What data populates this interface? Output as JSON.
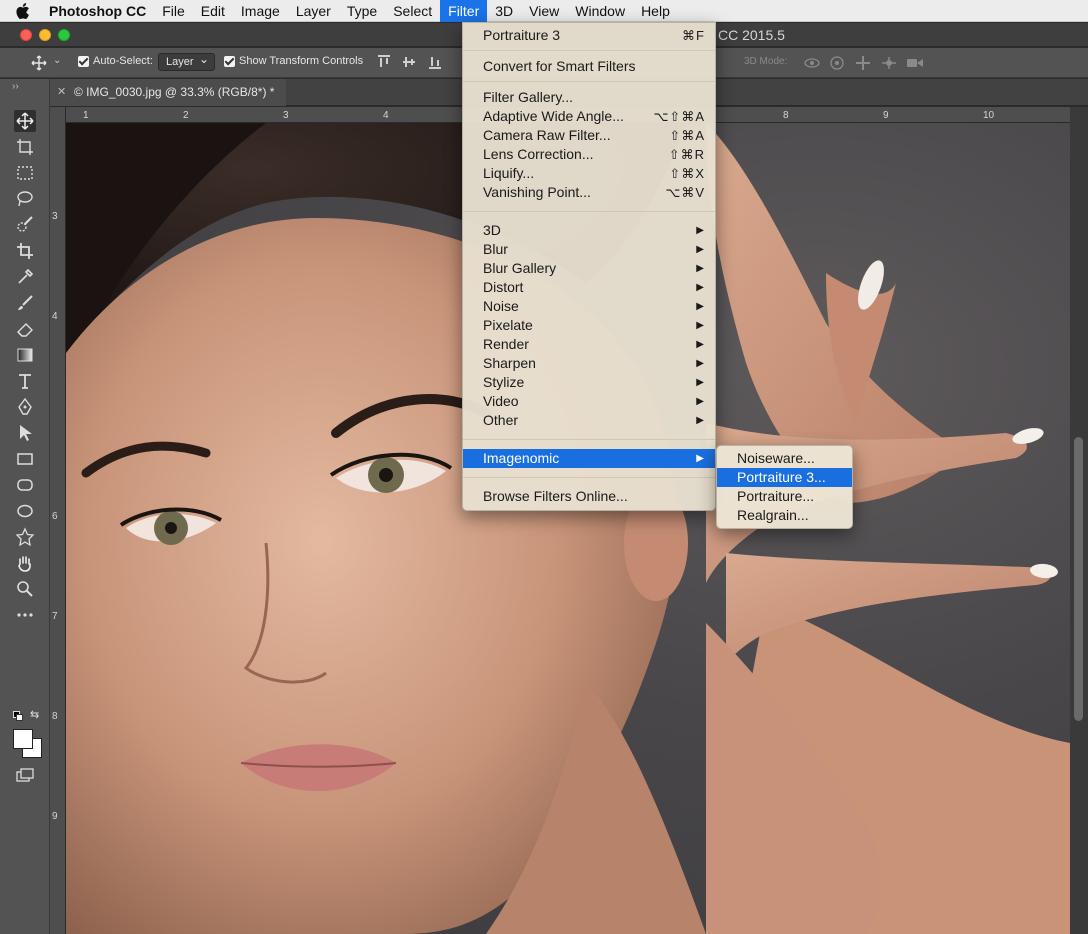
{
  "menubar": {
    "apple_icon": "apple-logo-icon",
    "app_name": "Photoshop CC",
    "items": [
      "File",
      "Edit",
      "Image",
      "Layer",
      "Type",
      "Select",
      "Filter",
      "3D",
      "View",
      "Window",
      "Help"
    ],
    "active": "Filter"
  },
  "window": {
    "title_fragment": "CC 2015.5"
  },
  "options_bar": {
    "auto_select_label": "Auto-Select:",
    "auto_select_checked": true,
    "auto_select_target": "Layer",
    "show_transform_label": "Show Transform Controls",
    "show_transform_checked": true,
    "mode_3d_label": "3D Mode:"
  },
  "document": {
    "tab_title": "© IMG_0030.jpg @ 33.3% (RGB/8*) *",
    "close_label": "✕"
  },
  "rulers": {
    "horizontal": [
      "1",
      "2",
      "3",
      "4",
      "8",
      "9",
      "10"
    ],
    "vertical": [
      "3",
      "4",
      "6",
      "7",
      "8",
      "9"
    ]
  },
  "filter_menu": {
    "last_filter": {
      "label": "Portraiture 3",
      "shortcut": "⌘F"
    },
    "convert": "Convert for Smart Filters",
    "filters": [
      {
        "label": "Filter Gallery...",
        "shortcut": ""
      },
      {
        "label": "Adaptive Wide Angle...",
        "shortcut": "⌥⇧⌘A"
      },
      {
        "label": "Camera Raw Filter...",
        "shortcut": "⇧⌘A"
      },
      {
        "label": "Lens Correction...",
        "shortcut": "⇧⌘R"
      },
      {
        "label": "Liquify...",
        "shortcut": "⇧⌘X"
      },
      {
        "label": "Vanishing Point...",
        "shortcut": "⌥⌘V"
      }
    ],
    "groups": [
      "3D",
      "Blur",
      "Blur Gallery",
      "Distort",
      "Noise",
      "Pixelate",
      "Render",
      "Sharpen",
      "Stylize",
      "Video",
      "Other"
    ],
    "plugin": "Imagenomic",
    "browse": "Browse Filters Online...",
    "submenu_arrow": "▶"
  },
  "imagenomic_submenu": {
    "items": [
      "Noiseware...",
      "Portraiture 3...",
      "Portraiture...",
      "Realgrain..."
    ],
    "highlighted": "Portraiture 3..."
  },
  "colors": {
    "accent": "#1a6fe0",
    "menu_bg": "#e8e0d0"
  }
}
